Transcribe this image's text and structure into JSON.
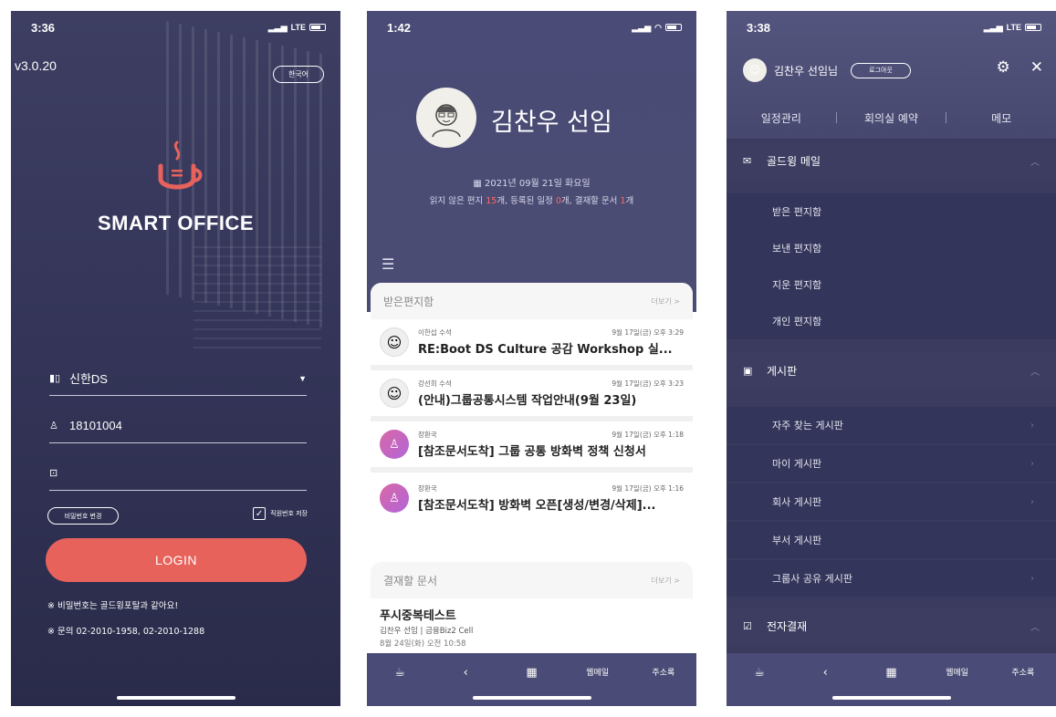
{
  "screen1": {
    "time": "3:36",
    "network": "LTE",
    "version": "v3.0.20",
    "lang_button": "한국어",
    "brand": "SMART OFFICE",
    "company_field": "신한DS",
    "id_field": "18101004",
    "password_field": "",
    "change_password_label": "비밀번호 변경",
    "save_id_label": "직원번호 저장",
    "save_id_check": "✓",
    "login_button": "LOGIN",
    "note1": "※ 비밀번호는 골드윙포탈과 같아요!",
    "note2": "※ 문의 02-2010-1958, 02-2010-1288",
    "accent_color": "#e8625c"
  },
  "screen2": {
    "time": "1:42",
    "name": "김찬우 선임",
    "date": "2021년 09월 21일 화요일",
    "summary_prefix": "읽지 않은 편지",
    "unread_count": "15",
    "summary_mid1": "개, 등록된 일정",
    "schedule_count": "0",
    "summary_mid2": "개, 결재할 문서",
    "approval_count": "1",
    "summary_suffix": "개",
    "inbox_title": "받은편지함",
    "more_label": "더보기 >",
    "mails": [
      {
        "sender": "이한섭 수석",
        "date": "9월 17일(금) 오후 3:29",
        "subject": "RE:Boot DS Culture 공감 Workshop 실..."
      },
      {
        "sender": "강선희 수석",
        "date": "9월 17일(금) 오후 3:23",
        "subject": "(안내)그룹공통시스템 작업안내(9월 23일)"
      },
      {
        "sender": "장환국",
        "date": "9월 17일(금) 오후 1:18",
        "subject": "[참조문서도착] 그룹 공통 방화벽 정책 신청서"
      },
      {
        "sender": "장환국",
        "date": "9월 17일(금) 오후 1:16",
        "subject": "[참조문서도착] 방화벽 오픈[생성/변경/삭제]..."
      }
    ],
    "approval_title": "결재할 문서",
    "doc": {
      "title": "푸시중복테스트",
      "meta": "김찬우 선임 | 금융Biz2 Cell",
      "date": "8월 24일(화) 오전 10:58"
    },
    "tab_mail": "웹메일",
    "tab_contacts": "주소록"
  },
  "screen3": {
    "time": "3:38",
    "network": "LTE",
    "user": "김찬우 선임님",
    "logout": "로그아웃",
    "tabs": [
      "일정관리",
      "회의실 예약",
      "메모"
    ],
    "sections": [
      {
        "title": "골드윙 메일",
        "items": [
          "받은 편지함",
          "보낸 편지함",
          "지운 편지함",
          "개인 편지함"
        ]
      },
      {
        "title": "게시판",
        "items": [
          "자주 찾는 게시판",
          "마이 게시판",
          "회사 게시판",
          "부서 게시판",
          "그룹사 공유 게시판"
        ]
      },
      {
        "title": "전자결재",
        "items": []
      }
    ],
    "tab_mail": "웹메일",
    "tab_contacts": "주소록"
  },
  "icons": [
    "cup-logo-icon",
    "building-icon",
    "user-icon",
    "lock-icon",
    "calendar-icon",
    "menu-icon",
    "mail-icon",
    "board-icon",
    "approval-icon",
    "gear-icon",
    "close-icon",
    "back-icon",
    "grid-icon"
  ]
}
